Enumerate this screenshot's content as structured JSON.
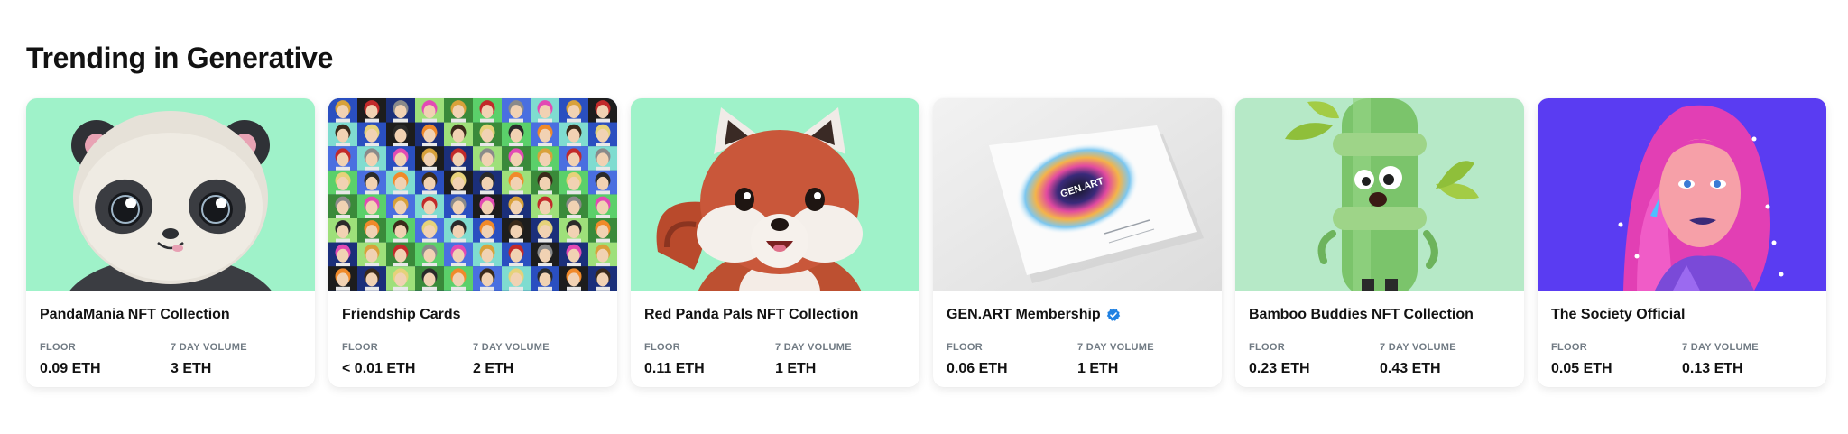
{
  "section": {
    "title": "Trending in Generative"
  },
  "cards": [
    {
      "name": "PandaMania NFT Collection",
      "verified": false,
      "floor_label": "FLOOR",
      "floor": "0.09 ETH",
      "volume_label": "7 DAY VOLUME",
      "volume": "3 ETH",
      "image_icon": "panda-character-icon"
    },
    {
      "name": "Friendship Cards",
      "verified": false,
      "floor_label": "FLOOR",
      "floor": "< 0.01 ETH",
      "volume_label": "7 DAY VOLUME",
      "volume": "2 ETH",
      "image_icon": "avatar-grid-icon"
    },
    {
      "name": "Red Panda Pals NFT Collection",
      "verified": false,
      "floor_label": "FLOOR",
      "floor": "0.11 ETH",
      "volume_label": "7 DAY VOLUME",
      "volume": "1 ETH",
      "image_icon": "red-panda-character-icon"
    },
    {
      "name": "GEN.ART Membership",
      "verified": true,
      "floor_label": "FLOOR",
      "floor": "0.06 ETH",
      "volume_label": "7 DAY VOLUME",
      "volume": "1 ETH",
      "image_icon": "membership-card-icon",
      "card_text": "GEN.ART"
    },
    {
      "name": "Bamboo Buddies NFT Collection",
      "verified": false,
      "floor_label": "FLOOR",
      "floor": "0.23 ETH",
      "volume_label": "7 DAY VOLUME",
      "volume": "0.43 ETH",
      "image_icon": "bamboo-character-icon"
    },
    {
      "name": "The Society Official",
      "verified": false,
      "floor_label": "FLOOR",
      "floor": "0.05 ETH",
      "volume_label": "7 DAY VOLUME",
      "volume": "0.13 ETH",
      "image_icon": "woman-portrait-icon"
    }
  ],
  "colors": {
    "mint_background": "#9ff2c9",
    "bamboo_background": "#b6e9c7",
    "society_background": "#5a3cf2",
    "verified_blue": "#2081e2"
  }
}
